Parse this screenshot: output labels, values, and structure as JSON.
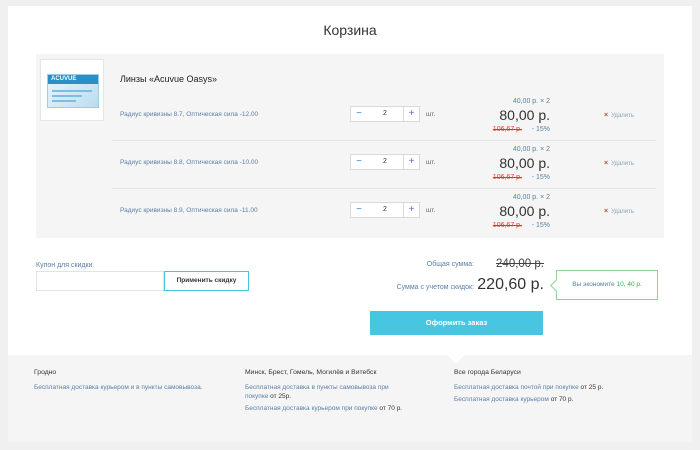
{
  "cart": {
    "title": "Корзина",
    "product_name": "Линзы «Acuvue Oasys»",
    "box_brand": "ACUVUE",
    "items": [
      {
        "param": "Радиус кривизны 8.7, Оптическая сила -12.00",
        "qty": "2",
        "unit": "шт.",
        "unit_price": "40,00 р. × 2",
        "total": "80,00 р.",
        "old_price": "106,67 р.",
        "discount": "- 15%",
        "remove": "Удалить"
      },
      {
        "param": "Радиус кривизны 8.8, Оптическая сила -10.00",
        "qty": "2",
        "unit": "шт.",
        "unit_price": "40,00 р. × 2",
        "total": "80,00 р.",
        "old_price": "106,67 р.",
        "discount": "- 15%",
        "remove": "Удалить"
      },
      {
        "param": "Радиус кривизны 8.9, Оптическая сила -11.00",
        "qty": "2",
        "unit": "шт.",
        "unit_price": "40,00 р. × 2",
        "total": "80,00 р.",
        "old_price": "106,67 р.",
        "discount": "- 15%",
        "remove": "Удалить"
      }
    ],
    "minus": "−",
    "plus": "+"
  },
  "coupon": {
    "label": "Купон для скидки",
    "value": "",
    "button": "Применить скидку"
  },
  "summary": {
    "total_label": "Общая сумма:",
    "total_old": "240,00 р.",
    "discounted_label": "Сумма с учетом скидок:",
    "total_new": "220,60 р.",
    "saving_text": "Вы экономите",
    "saving_amount": "10, 40 р."
  },
  "order_button": "Оформить заказ",
  "delivery": [
    {
      "city": "Гродно",
      "lines": [
        {
          "text": "Бесплатная доставка курьером и в пункты самовывоза.",
          "strong": ""
        }
      ]
    },
    {
      "city": "Минск, Брест, Гомель, Могилёв и Витебск",
      "lines": [
        {
          "text": "Бесплатная доставка в пункты самовывоза при покупке ",
          "strong": "от 25р."
        },
        {
          "text": "Бесплатная доставка курьером при покупке ",
          "strong": "от 70 р."
        }
      ]
    },
    {
      "city": "Все города Беларуси",
      "lines": [
        {
          "text": "Бесплатная доставка почтой при покупке ",
          "strong": "от 25 р."
        },
        {
          "text": "Бесплатная доставка курьером ",
          "strong": "от 70 р."
        }
      ]
    }
  ]
}
